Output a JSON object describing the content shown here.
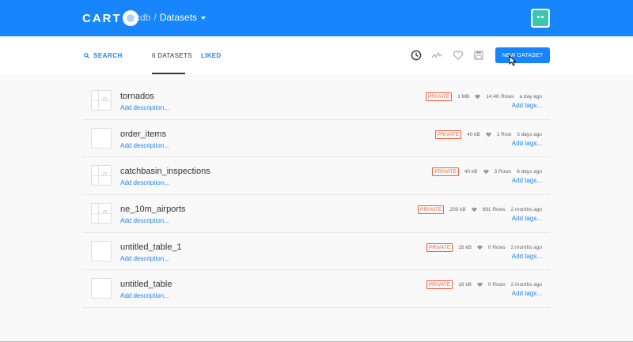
{
  "header": {
    "logo": "CART",
    "user": "cdb",
    "separator": "/",
    "current": "Datasets",
    "colors": {
      "brand": "#1785fb",
      "avatar": "#3bc6b0"
    }
  },
  "toolbar": {
    "search_label": "SEARCH",
    "tab_datasets": "6 DATASETS",
    "tab_liked": "LIKED",
    "new_dataset_label": "NEW DATASET",
    "icons": [
      "clock-icon",
      "activity-icon",
      "heart-icon",
      "save-icon"
    ]
  },
  "datasets": [
    {
      "name": "tornados",
      "description": "Add description...",
      "privacy": "PRIVATE",
      "size": "1 MB",
      "rows": "14.4K Rows",
      "updated": "a day ago",
      "tags": "Add tags...",
      "thumbnail": "map"
    },
    {
      "name": "order_items",
      "description": "Add description...",
      "privacy": "PRIVATE",
      "size": "40 kB",
      "rows": "1 Row",
      "updated": "3 days ago",
      "tags": "Add tags...",
      "thumbnail": "blank"
    },
    {
      "name": "catchbasin_inspections",
      "description": "Add description...",
      "privacy": "PRIVATE",
      "size": "40 kB",
      "rows": "3 Rows",
      "updated": "6 days ago",
      "tags": "Add tags...",
      "thumbnail": "map"
    },
    {
      "name": "ne_10m_airports",
      "description": "Add description...",
      "privacy": "PRIVATE",
      "size": "200 kB",
      "rows": "891 Rows",
      "updated": "2 months ago",
      "tags": "Add tags...",
      "thumbnail": "map"
    },
    {
      "name": "untitled_table_1",
      "description": "Add description...",
      "privacy": "PRIVATE",
      "size": "16 kB",
      "rows": "0 Rows",
      "updated": "2 months ago",
      "tags": "Add tags...",
      "thumbnail": "blank"
    },
    {
      "name": "untitled_table",
      "description": "Add description...",
      "privacy": "PRIVATE",
      "size": "16 kB",
      "rows": "0 Rows",
      "updated": "2 months ago",
      "tags": "Add tags...",
      "thumbnail": "blank"
    }
  ]
}
